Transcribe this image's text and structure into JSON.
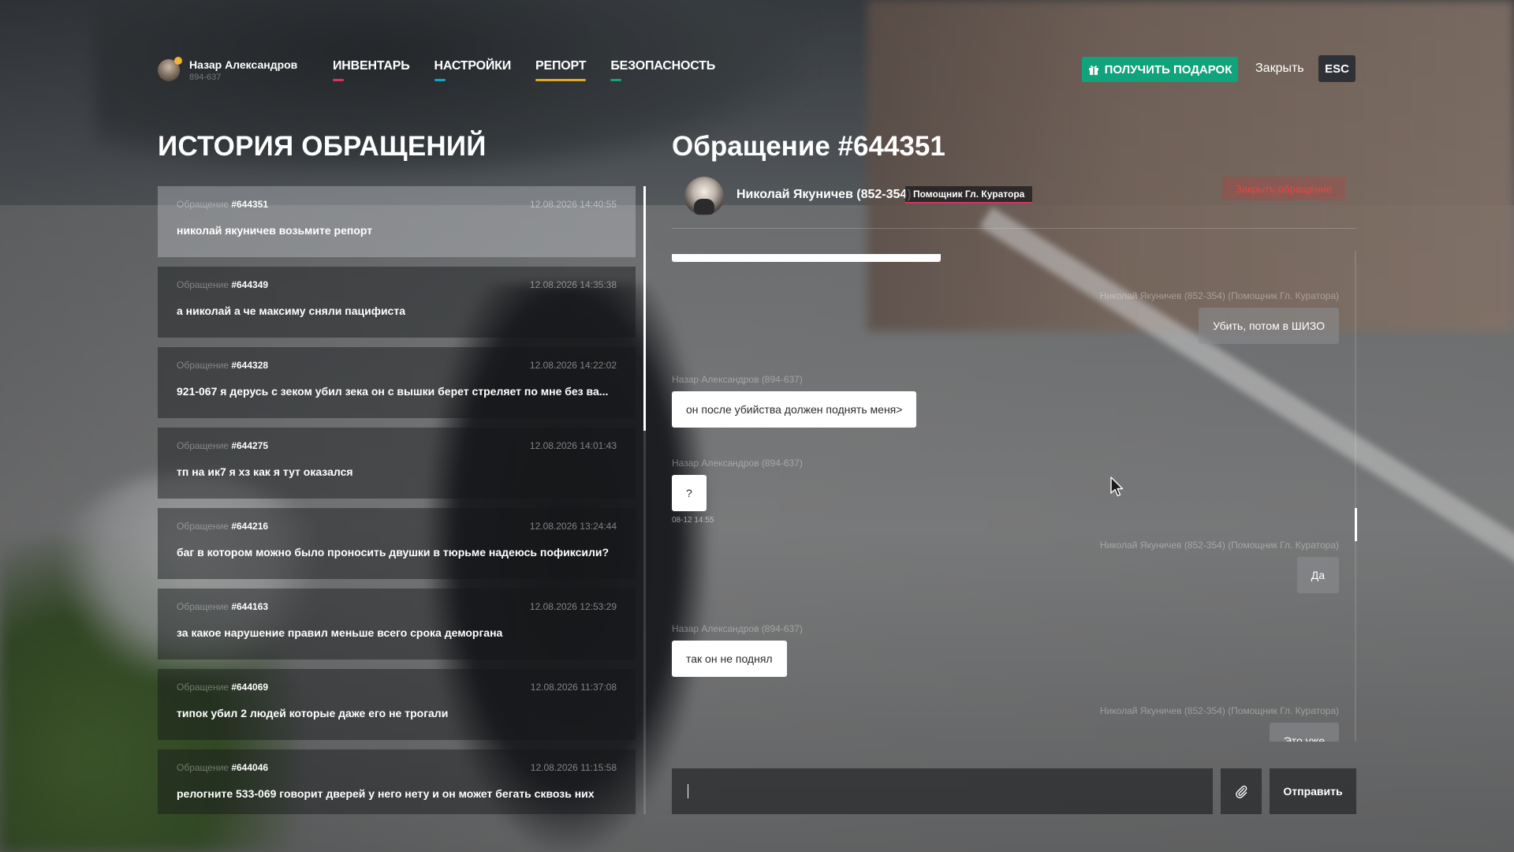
{
  "profile": {
    "name": "Назар Александров",
    "id": "894-637"
  },
  "nav": [
    {
      "label": "ИНВЕНТАРЬ",
      "color": "#d8345f",
      "active": false
    },
    {
      "label": "НАСТРОЙКИ",
      "color": "#10a3c9",
      "active": false
    },
    {
      "label": "РЕПОРТ",
      "color": "#e2a829",
      "active": true
    },
    {
      "label": "БЕЗОПАСНОСТЬ",
      "color": "#10a37c",
      "active": false
    }
  ],
  "header": {
    "gift_label": "ПОЛУЧИТЬ ПОДАРОК",
    "close_label": "Закрыть",
    "esc_label": "ESC"
  },
  "history": {
    "title": "ИСТОРИЯ ОБРАЩЕНИЙ",
    "prefix": "Обращение",
    "items": [
      {
        "num": "#644351",
        "date": "12.08.2026 14:40:55",
        "text": "николай якуничев возьмите репорт"
      },
      {
        "num": "#644349",
        "date": "12.08.2026 14:35:38",
        "text": "а николай а че максиму сняли пацифиста"
      },
      {
        "num": "#644328",
        "date": "12.08.2026 14:22:02",
        "text": "921-067 я дерусь с зеком убил зека он с вышки берет стреляет по мне без ва..."
      },
      {
        "num": "#644275",
        "date": "12.08.2026 14:01:43",
        "text": "тп на ик7 я хз как я тут оказался"
      },
      {
        "num": "#644216",
        "date": "12.08.2026 13:24:44",
        "text": "баг в котором можно было проносить двушки в тюрьме надеюсь пофиксили?"
      },
      {
        "num": "#644163",
        "date": "12.08.2026 12:53:29",
        "text": "за какое нарушение правил меньше всего срока деморгана"
      },
      {
        "num": "#644069",
        "date": "12.08.2026 11:37:08",
        "text": "типок убил 2 людей которые даже его не трогали"
      },
      {
        "num": "#644046",
        "date": "12.08.2026 11:15:58",
        "text": "релогните 533-069 говорит дверей у него нету и он может бегать сквозь них"
      }
    ]
  },
  "ticket": {
    "title": "Обращение #644351",
    "admin_name": "Николай Якуничев (852-354)",
    "admin_role": "Помощник Гл. Куратора",
    "close_label": "Закрыть обращение"
  },
  "chat": {
    "messages": [
      {
        "author": "Николай Якуничев (852-354) (Помощник Гл. Куратора)",
        "text": "Убить, потом в ШИЗО",
        "side": "theirs"
      },
      {
        "author": "Назар Александров (894-637)",
        "text": "он после убийства должен поднять меня>",
        "side": "mine"
      },
      {
        "author": "Назар Александров (894-637)",
        "text": "?",
        "side": "mine",
        "time": "08-12 14:55"
      },
      {
        "author": "Николай Якуничев (852-354) (Помощник Гл. Куратора)",
        "text": "Да",
        "side": "theirs"
      },
      {
        "author": "Назар Александров (894-637)",
        "text": "так он не поднял",
        "side": "mine"
      },
      {
        "author": "Николай Якуничев (852-354) (Помощник Гл. Куратора)",
        "text": "Это уже",
        "side": "theirs"
      }
    ]
  },
  "composer": {
    "placeholder": "",
    "send_label": "Отправить"
  },
  "icons": {
    "gift": "gift-icon",
    "attach": "paperclip-icon",
    "cursor": "mouse-cursor-icon"
  }
}
